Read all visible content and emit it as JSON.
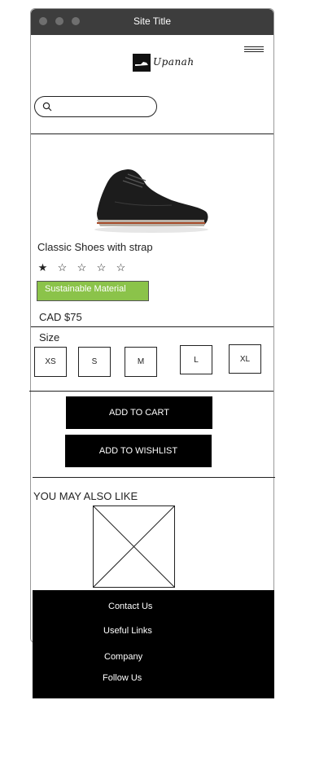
{
  "window": {
    "title": "Site Title"
  },
  "brand": {
    "logo_text": "Upanah"
  },
  "search": {
    "placeholder": "",
    "value": ""
  },
  "product": {
    "name": "Classic Shoes with strap",
    "rating": {
      "filled": 1,
      "total": 5
    },
    "badge": "Sustainable Material",
    "badge_color": "#8bc34a",
    "price": "CAD $75"
  },
  "size": {
    "label": "Size",
    "options": [
      "XS",
      "S",
      "M",
      "L",
      "XL"
    ]
  },
  "actions": {
    "add_to_cart": "ADD TO CART",
    "add_to_wishlist": "ADD TO WISHLIST"
  },
  "recommendations": {
    "heading": "YOU MAY ALSO LIKE"
  },
  "footer": {
    "links": [
      "Contact Us",
      "Useful Links",
      "Company",
      "Follow Us"
    ]
  },
  "icons": {
    "search": "search-icon",
    "menu": "hamburger-menu-icon",
    "image_placeholder": "image-placeholder-icon"
  }
}
